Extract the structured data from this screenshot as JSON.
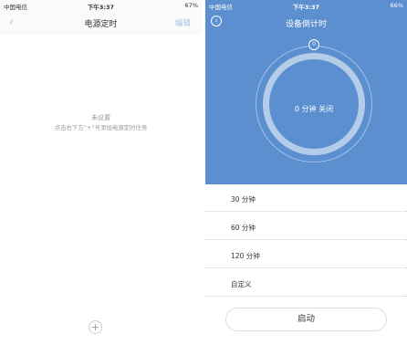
{
  "left": {
    "status": {
      "carrier": "中国电信",
      "time": "下午3:37",
      "battery": "67%"
    },
    "nav": {
      "back_icon": "back-chevron",
      "title": "电源定时",
      "action": "编辑"
    },
    "empty": {
      "title": "未设置",
      "description": "点击右下方“+”号添加电源定时任务"
    },
    "add_label": "+"
  },
  "right": {
    "status": {
      "carrier": "中国电信",
      "time": "下午3:37",
      "battery": "66%"
    },
    "nav": {
      "back_icon": "back-circle",
      "title": "设备倒计时"
    },
    "timer": {
      "display": "0 分钟  关闭",
      "accent": "#5b8fcf",
      "knob_label": "0"
    },
    "options": [
      "30 分钟",
      "60 分钟",
      "120 分钟",
      "自定义"
    ],
    "start_label": "启动"
  }
}
